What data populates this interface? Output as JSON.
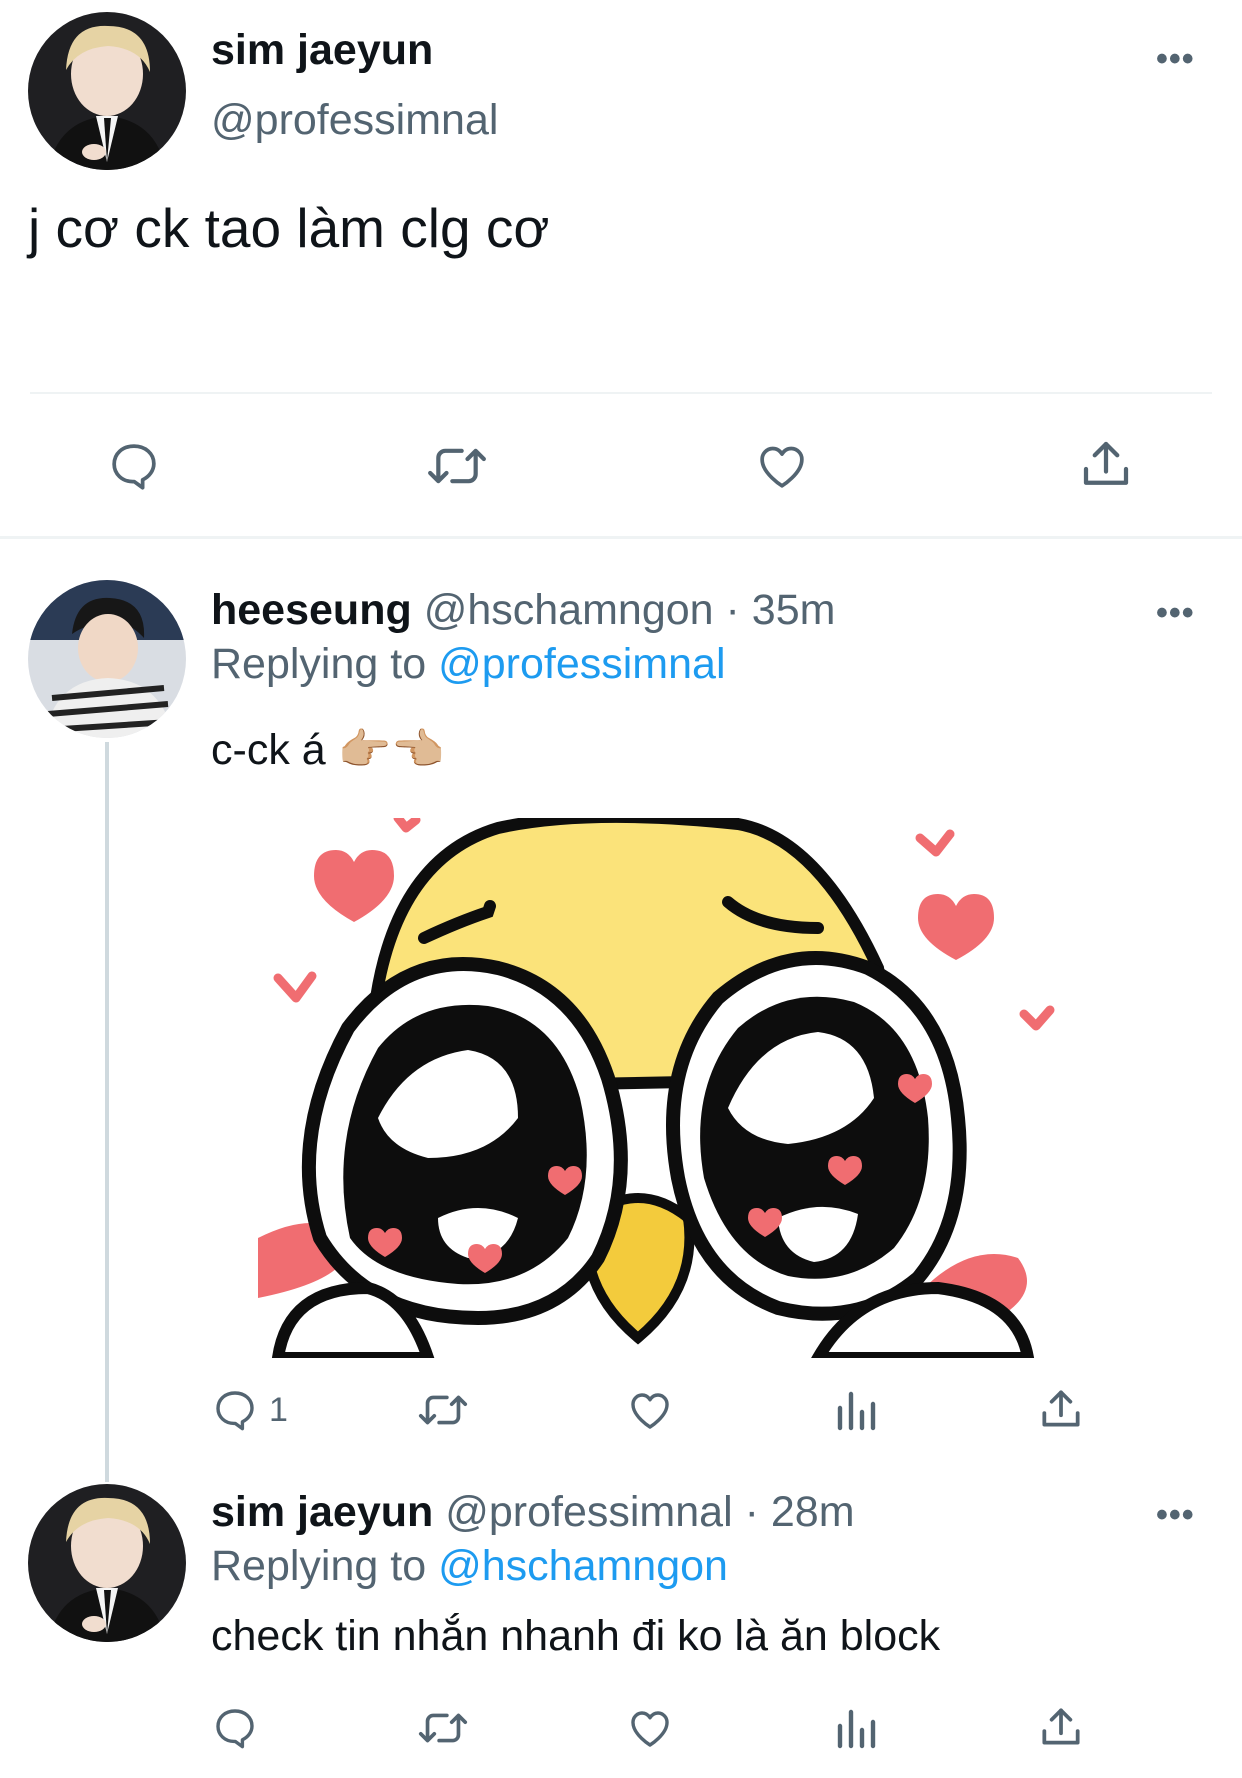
{
  "main_tweet": {
    "name": "sim jaeyun",
    "handle": "@professimnal",
    "text": "j cơ ck tao làm clg cơ",
    "more_icon": "more-horizontal-icon",
    "actions": [
      "reply-icon",
      "retweet-icon",
      "like-icon",
      "share-icon"
    ]
  },
  "replies": [
    {
      "name": "heeseung",
      "handle": "@hschamngon",
      "time": "· 35m",
      "replying_label": "Replying to",
      "replying_to": "@professimnal",
      "text": "c-ck á 👉🏼👈🏼",
      "image_icon": "crying-duck-sticker",
      "reply_count": "1",
      "actions": [
        "reply-icon",
        "retweet-icon",
        "like-icon",
        "analytics-icon",
        "share-icon"
      ]
    },
    {
      "name": "sim jaeyun",
      "handle": "@professimnal",
      "time": "· 28m",
      "replying_label": "Replying to",
      "replying_to": "@hschamngon",
      "text": "check tin nhắn nhanh đi ko là ăn block",
      "actions": [
        "reply-icon",
        "retweet-icon",
        "like-icon",
        "analytics-icon",
        "share-icon"
      ]
    }
  ],
  "colors": {
    "accent": "#1d9bf0",
    "secondary_text": "#536471",
    "icon": "#536471",
    "divider": "#eff3f4"
  }
}
